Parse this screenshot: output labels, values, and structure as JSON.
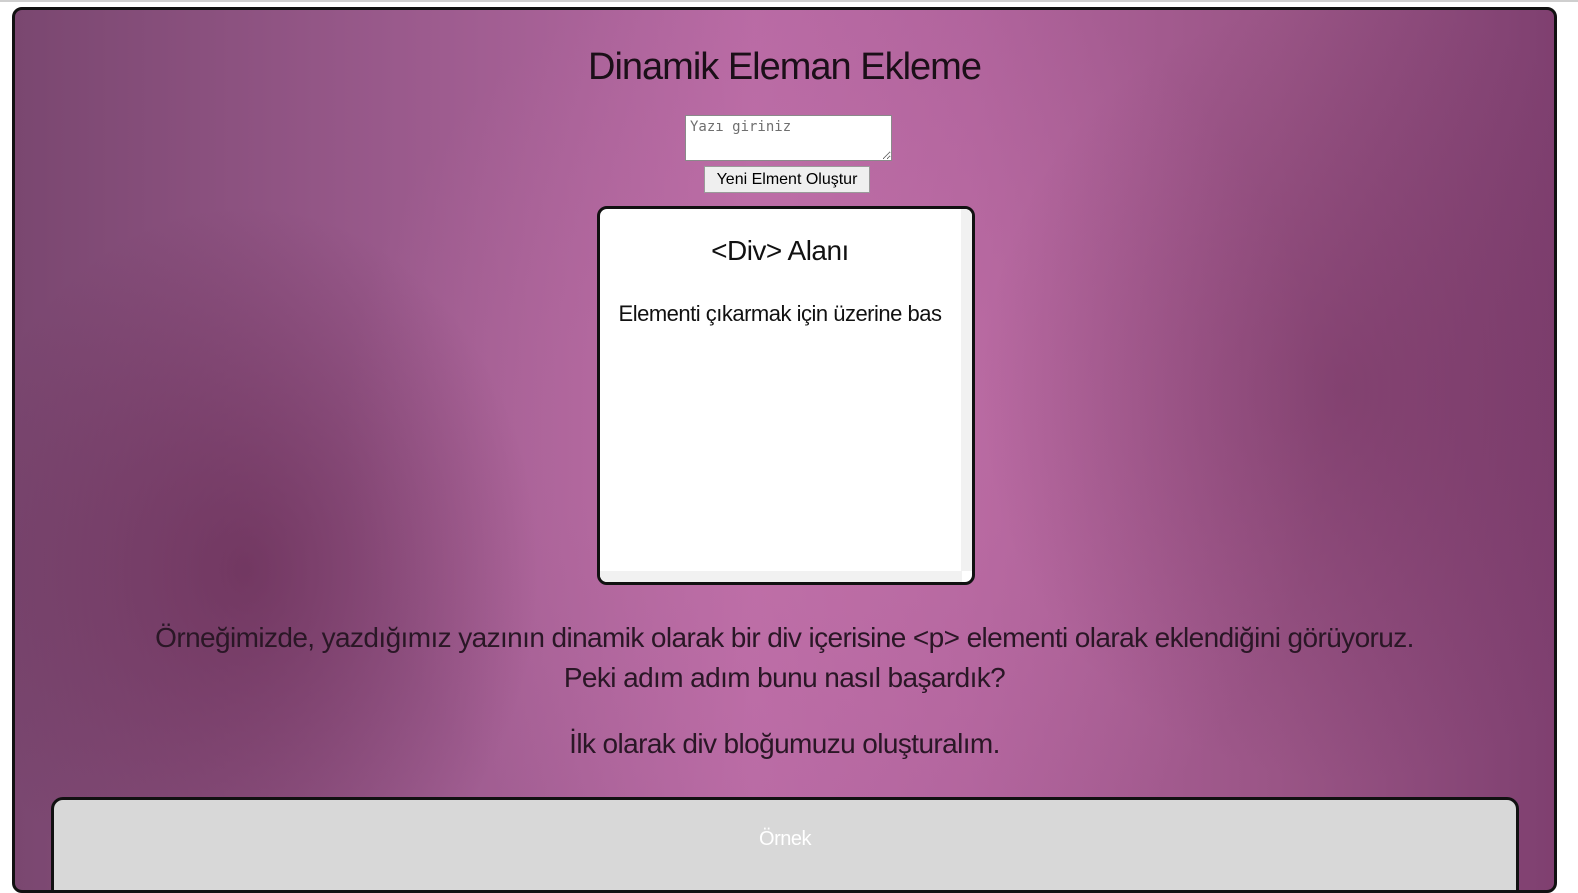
{
  "page": {
    "title": "Dinamik Eleman Ekleme"
  },
  "form": {
    "input_placeholder": "Yazı giriniz",
    "input_value": "",
    "create_button_label": "Yeni Elment Oluştur"
  },
  "div_area": {
    "title": "<Div> Alanı",
    "hint": "Elementi çıkarmak için üzerine bas"
  },
  "content": {
    "description_line1": "Örneğimizde, yazdığımız yazının dinamik olarak bir div içerisine <p> elementi olarak eklendiğini görüyoruz.",
    "description_line2": "Peki adım adım bunu nasıl başardık?",
    "first_step": "İlk olarak div bloğumuzu oluşturalım."
  },
  "example": {
    "label": "Örnek"
  },
  "colors": {
    "background_accent": "#b86aa4",
    "frame_border": "#111111",
    "example_box_bg": "#d8d8d8"
  }
}
